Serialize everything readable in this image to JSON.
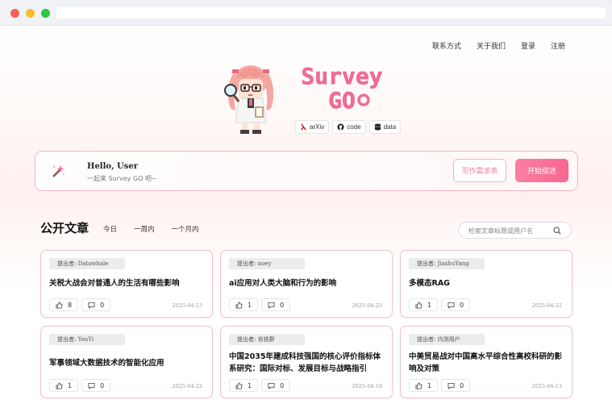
{
  "nav": {
    "items": [
      "联系方式",
      "关于我们",
      "登录",
      "注册"
    ]
  },
  "hero": {
    "logo_line1": "Survey",
    "logo_line2": "GO",
    "links": [
      {
        "label": "arXiv",
        "icon": "arxiv-icon"
      },
      {
        "label": "code",
        "icon": "github-icon"
      },
      {
        "label": "data",
        "icon": "database-icon"
      }
    ]
  },
  "welcome": {
    "title": "Hello, User",
    "subtitle": "一起来 Survey GO 吧~",
    "secondary_button": "写作需求表",
    "primary_button": "开始综述"
  },
  "articles": {
    "heading": "公开文章",
    "filters": [
      "今日",
      "一周内",
      "一个月内"
    ],
    "search_placeholder": "检索文章标题或用户名",
    "cards": [
      {
        "author": "提出者: Datawhale",
        "title": "关税大战会对普通人的生活有哪些影响",
        "likes": "8",
        "comments": "0",
        "date": "2025-04-13"
      },
      {
        "author": "提出者: noey",
        "title": "ai应用对人类大脑和行为的影响",
        "likes": "1",
        "comments": "0",
        "date": "2025-04-23"
      },
      {
        "author": "提出者: JiashuYang",
        "title": "多模态RAG",
        "likes": "1",
        "comments": "0",
        "date": "2025-04-22"
      },
      {
        "author": "提出者: YouYi",
        "title": "军事领域大数据技术的智能化应用",
        "likes": "1",
        "comments": "0",
        "date": "2025-04-22"
      },
      {
        "author": "提出者: 肖铁群",
        "title": "中国2035年建成科技强国的核心评价指标体系研究：国际对标、发展目标与战略指引",
        "likes": "1",
        "comments": "0",
        "date": "2025-04-18"
      },
      {
        "author": "提出者: 内测用户",
        "title": "中美贸易战对中国高水平综合性高校科研的影响及对策",
        "likes": "1",
        "comments": "0",
        "date": "2025-04-13"
      }
    ]
  },
  "colors": {
    "accent": "#f56891",
    "accent_light": "#f3b1c0",
    "logo": "#f36c95"
  }
}
